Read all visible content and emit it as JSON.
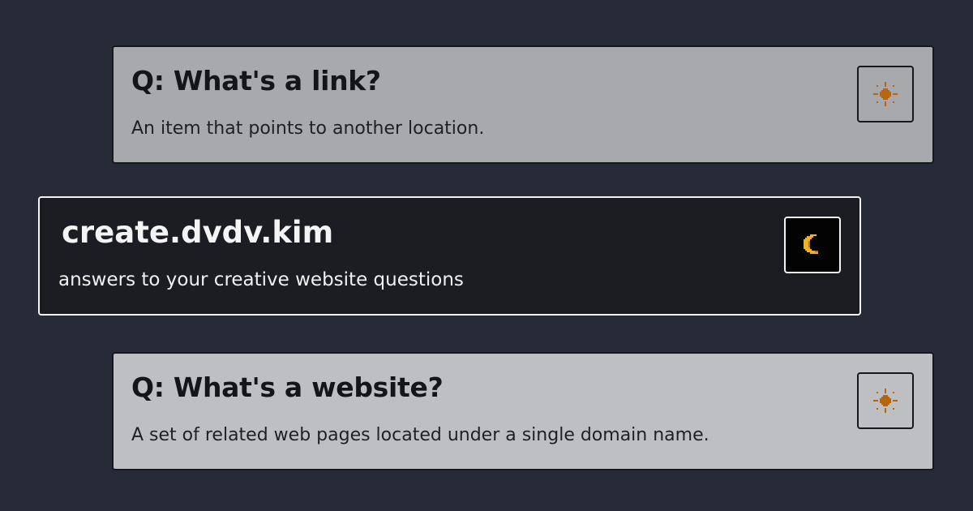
{
  "cards": {
    "top": {
      "question": "Q: What's a link?",
      "answer": "An item that points to another location.",
      "theme_icon": "sun-icon"
    },
    "header": {
      "title": "create.dvdv.kim",
      "tagline": "answers to your creative website questions",
      "theme_icon": "moon-icon"
    },
    "bottom": {
      "question": "Q: What's a website?",
      "answer": "A set of related web pages located under a single domain name.",
      "theme_icon": "sun-icon"
    }
  },
  "colors": {
    "page_background": "#272b38",
    "card_top_background": "#a8a9ad",
    "card_bottom_background": "#bebfc2",
    "card_dark_background": "#1c1d22",
    "sun_color": "#b8650f",
    "moon_color": "#f2b21a"
  }
}
